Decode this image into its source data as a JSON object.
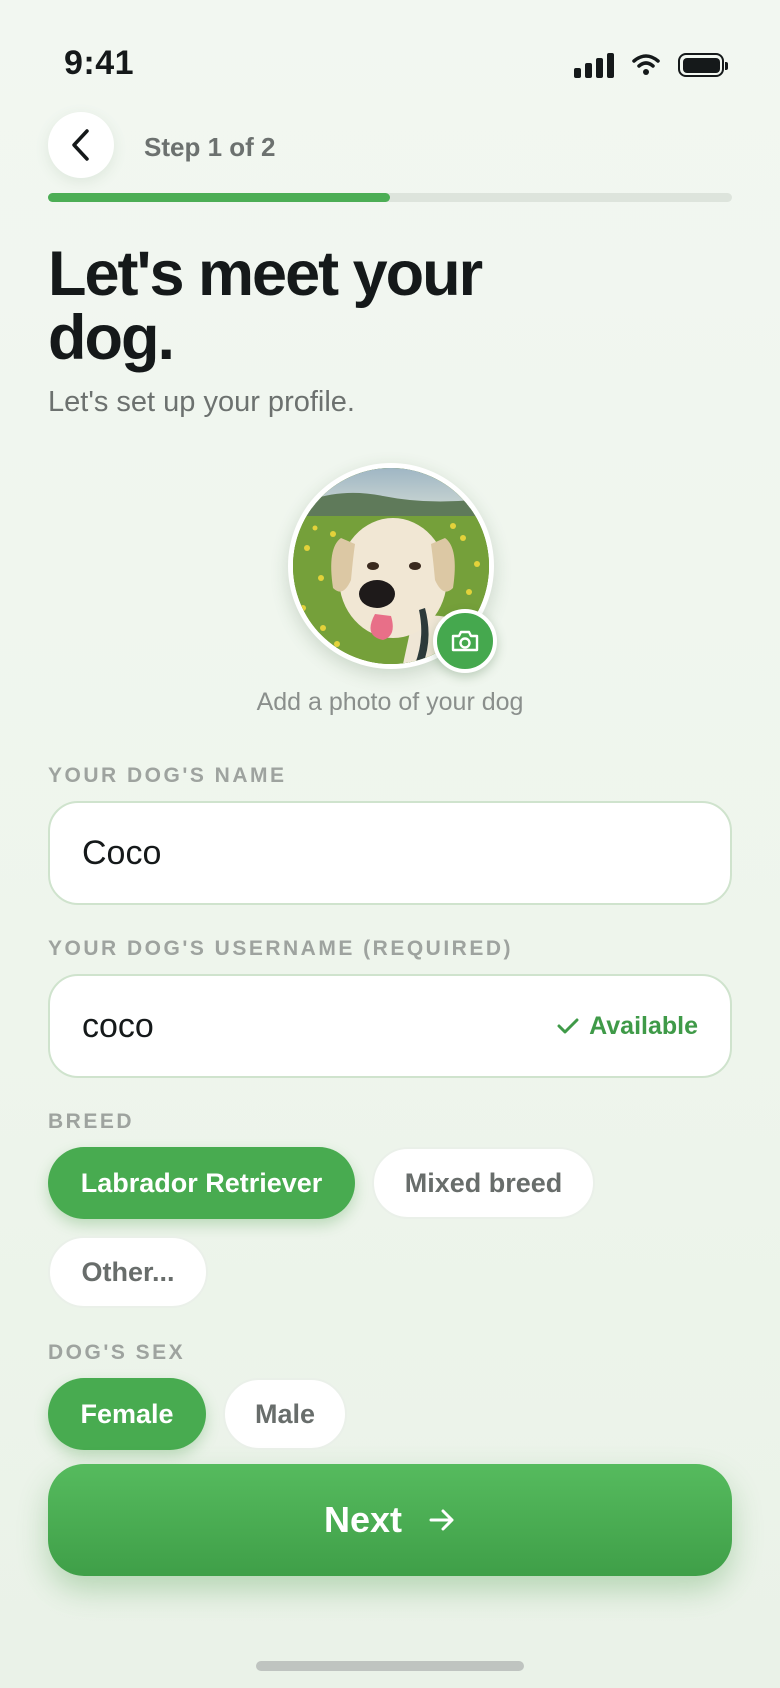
{
  "status_bar": {
    "time": "9:41",
    "icons": [
      "signal-icon",
      "wifi-icon",
      "battery-icon"
    ]
  },
  "nav": {
    "back_icon": "chevron-left-icon",
    "step_label": "Step 1 of 2",
    "progress": 0.5
  },
  "header": {
    "title": "Let's meet your dog.",
    "subtitle": "Let's set up your profile."
  },
  "photo": {
    "caption": "Add a photo of your dog",
    "camera_icon": "camera-icon"
  },
  "name_field": {
    "label": "YOUR DOG'S NAME",
    "value": "Coco"
  },
  "username_field": {
    "label": "YOUR DOG'S USERNAME (REQUIRED)",
    "value": "coco",
    "status": "Available",
    "status_icon": "check-icon"
  },
  "breed": {
    "label": "BREED",
    "options": [
      {
        "label": "Labrador Retriever",
        "selected": true
      },
      {
        "label": "Mixed breed",
        "selected": false
      },
      {
        "label": "Other...",
        "selected": false
      }
    ]
  },
  "sex": {
    "label": "DOG'S SEX",
    "options": [
      {
        "label": "Female",
        "selected": true
      },
      {
        "label": "Male",
        "selected": false
      }
    ]
  },
  "next_button": {
    "label": "Next",
    "icon": "arrow-right-icon"
  },
  "colors": {
    "accent": "#48ab50",
    "text": "#15191a",
    "muted": "#6c716f",
    "background": "#f0f6ef"
  }
}
